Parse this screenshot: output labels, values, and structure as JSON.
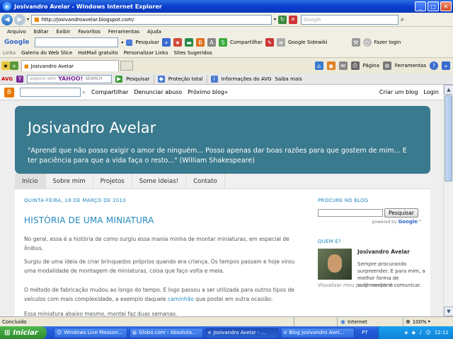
{
  "window": {
    "title": "Josivandro Avelar - Windows Internet Explorer",
    "btn_min": "_",
    "btn_max": "□",
    "btn_close": "✕"
  },
  "address": {
    "url": "http://josivandroavelar.blogspot.com/",
    "search_placeholder": "Google"
  },
  "menu": [
    "Arquivo",
    "Editar",
    "Exibir",
    "Favoritos",
    "Ferramentas",
    "Ajuda"
  ],
  "google_toolbar": {
    "logo": "Google",
    "pesquisar": "Pesquisar",
    "compartilhar": "Compartilhar",
    "sidewiki": "Google Sidewiki",
    "fazer_login": "Fazer login"
  },
  "links_bar": {
    "label": "Links",
    "items": [
      "Galeria do Web Slice",
      "HotMail gratuito",
      "Personalizar Links",
      "Sites Sugeridos"
    ]
  },
  "tab": {
    "title": "Josivandro Avelar"
  },
  "ie_cmd": {
    "pagina": "Página",
    "ferramentas": "Ferramentas"
  },
  "avg_bar": {
    "avg": "AVG",
    "yahoo_hint": "explore with",
    "yahoo": "YAHOO!",
    "search": "SEARCH",
    "pesquisar": "Pesquisar",
    "protecao": "Proteção total",
    "info": "Informações do AVG",
    "saiba": "Saiba mais"
  },
  "blogger_bar": {
    "compartilhar": "Compartilhar",
    "denunciar": "Denunciar abuso",
    "proximo": "Próximo blog»",
    "criar": "Criar um blog",
    "login": "Login"
  },
  "blog": {
    "title": "Josivandro Avelar",
    "description": "\"Aprendi que não posso exigir o amor de ninguém... Posso apenas dar boas razões para que gostem de mim... E ter paciência para que a vida faça o resto...\" (William Shakespeare)",
    "nav": [
      "Início",
      "Sobre mim",
      "Projetos",
      "Some Ideias!",
      "Contato"
    ],
    "post_date": "QUINTA-FEIRA, 18 DE MARÇO DE 2010",
    "post_title": "HISTÓRIA DE UMA MINIATURA",
    "paragraphs": [
      "No geral, essa é a história de como surgiu essa mania minha de montar miniaturas, em especial de ônibus.",
      "Surgiu de uma ideia de criar brinquedos próprios quando era criança. Os tempos passam e hoje virou uma modalidade de montagem de miniaturas, coisa que faço volta e meia.",
      "O método de fabricação mudou ao longo do tempo. E logo passou a ser utilizada para outros tipos de veículos com mais complexidade, a exemplo daquele",
      "Essa miniatura abaixo mesmo, montei faz duas semanas."
    ],
    "para3_link": "caminhão",
    "para3_end": " que postei em outra ocasião.",
    "sidebar": {
      "search_title": "PROCURE NO BLOG",
      "search_button": "Pesquisar",
      "powered_by": "powered by",
      "powered_google": "Google",
      "powered_tm": "™",
      "about_title": "QUEM É?",
      "author": "Josivandro Avelar",
      "bio": "Sempre procurando surpreender. E para mim, a melhor forma de surpreender é comunicar.",
      "profile_link": "Visualizar meu perfil completo"
    }
  },
  "status": {
    "text": "Concluído",
    "zone": "Internet",
    "zoom": "100%"
  },
  "taskbar": {
    "start": "Iniciar",
    "tasks": [
      "Windows Live Messen...",
      "Globo.com - Absoluta...",
      "Josivandro Avelar - ...",
      "Blog Josivandro Avel..."
    ],
    "lang": "PT",
    "clock": "12:11"
  }
}
